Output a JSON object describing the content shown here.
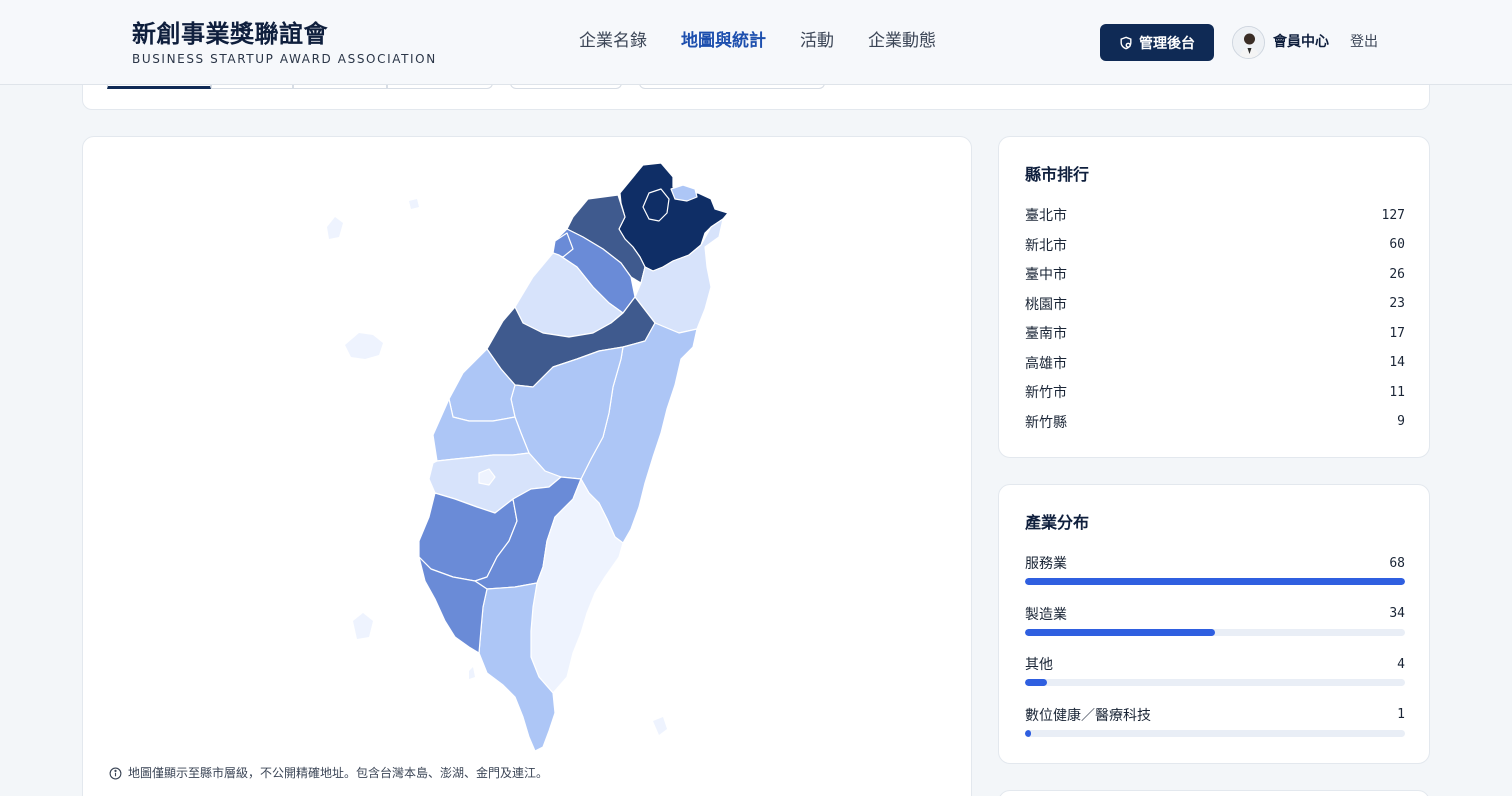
{
  "brand": {
    "title": "新創事業獎聯誼會",
    "subtitle": "BUSINESS STARTUP AWARD ASSOCIATION"
  },
  "nav": {
    "items": [
      {
        "label": "企業名錄",
        "active": false
      },
      {
        "label": "地圖與統計",
        "active": true
      },
      {
        "label": "活動",
        "active": false
      },
      {
        "label": "企業動態",
        "active": false
      }
    ]
  },
  "header": {
    "admin_label": "管理後台",
    "member_label": "會員中心",
    "logout_label": "登出"
  },
  "map": {
    "note": "地圖僅顯示至縣市層級，不公開精確地址。包含台灣本島、澎湖、金門及連江。",
    "scale_colors": [
      "#eef3fe",
      "#d7e3fb",
      "#adc6f6",
      "#6a8bd7",
      "#3f5a8e",
      "#0f2e66"
    ]
  },
  "ranking": {
    "title": "縣市排行",
    "items": [
      {
        "name": "臺北市",
        "value": "127"
      },
      {
        "name": "新北市",
        "value": "60"
      },
      {
        "name": "臺中市",
        "value": "26"
      },
      {
        "name": "桃園市",
        "value": "23"
      },
      {
        "name": "臺南市",
        "value": "17"
      },
      {
        "name": "高雄市",
        "value": "14"
      },
      {
        "name": "新竹市",
        "value": "11"
      },
      {
        "name": "新竹縣",
        "value": "9"
      }
    ]
  },
  "industry": {
    "title": "產業分布",
    "max": 68,
    "items": [
      {
        "name": "服務業",
        "value": 68
      },
      {
        "name": "製造業",
        "value": 34
      },
      {
        "name": "其他",
        "value": 4
      },
      {
        "name": "數位健康／醫療科技",
        "value": 1
      }
    ]
  },
  "colors": {
    "accent": "#0f2a55",
    "nav_active": "#1d4fae",
    "bar": "#2f5fe0"
  }
}
